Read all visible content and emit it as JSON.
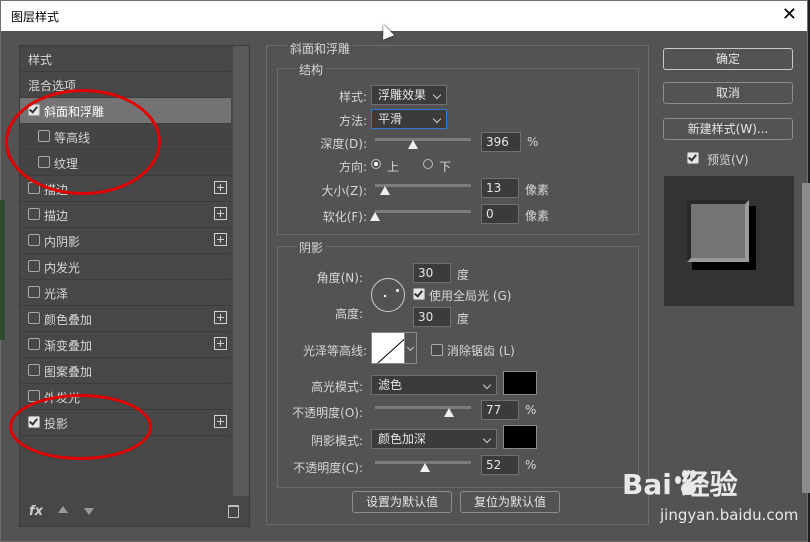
{
  "window": {
    "title": "图层样式"
  },
  "styles_list": {
    "header": "样式",
    "blend": "混合选项",
    "items": [
      {
        "label": "斜面和浮雕",
        "checked": true,
        "selected": true,
        "sub": false,
        "plus": false
      },
      {
        "label": "等高线",
        "checked": false,
        "selected": false,
        "sub": true,
        "plus": false
      },
      {
        "label": "纹理",
        "checked": false,
        "selected": false,
        "sub": true,
        "plus": false
      },
      {
        "label": "描边",
        "checked": false,
        "selected": false,
        "sub": false,
        "plus": true
      },
      {
        "label": "描边",
        "checked": false,
        "selected": false,
        "sub": false,
        "plus": true
      },
      {
        "label": "内阴影",
        "checked": false,
        "selected": false,
        "sub": false,
        "plus": true
      },
      {
        "label": "内发光",
        "checked": false,
        "selected": false,
        "sub": false,
        "plus": false
      },
      {
        "label": "光泽",
        "checked": false,
        "selected": false,
        "sub": false,
        "plus": false
      },
      {
        "label": "颜色叠加",
        "checked": false,
        "selected": false,
        "sub": false,
        "plus": true
      },
      {
        "label": "渐变叠加",
        "checked": false,
        "selected": false,
        "sub": false,
        "plus": true
      },
      {
        "label": "图案叠加",
        "checked": false,
        "selected": false,
        "sub": false,
        "plus": false
      },
      {
        "label": "外发光",
        "checked": false,
        "selected": false,
        "sub": false,
        "plus": false
      },
      {
        "label": "投影",
        "checked": true,
        "selected": false,
        "sub": false,
        "plus": true
      }
    ],
    "footer": {
      "fx": "fx"
    }
  },
  "bevel": {
    "title": "斜面和浮雕",
    "structure": {
      "title": "结构",
      "style_label": "样式:",
      "style_value": "浮雕效果",
      "technique_label": "方法:",
      "technique_value": "平滑",
      "depth_label": "深度(D):",
      "depth_value": "396",
      "depth_unit": "%",
      "depth_pos": 0.4,
      "direction_label": "方向:",
      "direction_up": "上",
      "direction_down": "下",
      "size_label": "大小(Z):",
      "size_value": "13",
      "size_unit": "像素",
      "size_pos": 0.1,
      "soften_label": "软化(F):",
      "soften_value": "0",
      "soften_unit": "像素",
      "soften_pos": 0.0
    },
    "shading": {
      "title": "阴影",
      "angle_label": "角度(N):",
      "angle_value": "30",
      "angle_unit": "度",
      "global_light_label": "使用全局光 (G)",
      "global_light_checked": true,
      "altitude_label": "高度:",
      "altitude_value": "30",
      "altitude_unit": "度",
      "gloss_label": "光泽等高线:",
      "antialias_label": "消除锯齿 (L)",
      "antialias_checked": false,
      "highlight_mode_label": "高光模式:",
      "highlight_mode_value": "滤色",
      "highlight_color": "#000000",
      "highlight_opacity_label": "不透明度(O):",
      "highlight_opacity_value": "77",
      "highlight_opacity_unit": "%",
      "highlight_opacity_pos": 0.77,
      "shadow_mode_label": "阴影模式:",
      "shadow_mode_value": "颜色加深",
      "shadow_color": "#000000",
      "shadow_opacity_label": "不透明度(C):",
      "shadow_opacity_value": "52",
      "shadow_opacity_unit": "%",
      "shadow_opacity_pos": 0.52
    },
    "make_default": "设置为默认值",
    "reset_default": "复位为默认值"
  },
  "actions": {
    "ok": "确定",
    "cancel": "取消",
    "new_style": "新建样式(W)...",
    "preview_label": "预览(V)",
    "preview_checked": true
  },
  "watermark": {
    "brand": "Bai  经验",
    "url": "jingyan.baidu.com"
  }
}
